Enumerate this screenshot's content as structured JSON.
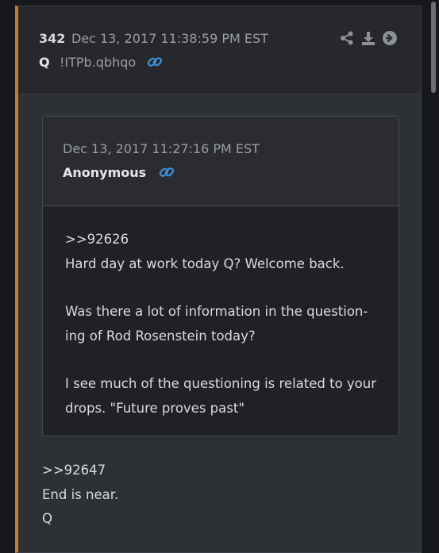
{
  "post": {
    "number": "342",
    "date": "Dec 13, 2017 11:38:59 PM EST",
    "author": "Q",
    "tripcode": "!ITPb.qbhqo",
    "icons": [
      "share-icon",
      "download-icon",
      "arrow-right-circle-icon",
      "link-icon"
    ],
    "accent_color": "#c87a35",
    "reply_lines": [
      ">>92647",
      "End is near.",
      "Q"
    ]
  },
  "quoted": {
    "date": "Dec 13, 2017 11:27:16 PM EST",
    "author": "Anonymous",
    "lines": [
      ">>92626",
      "Hard day at work today Q? Welcome back.",
      "",
      "Was there a lot of information in the question-",
      "ing of Rod Rosenstein today?",
      "",
      "I see much of the questioning is related to your",
      "drops.  \"Future proves past\""
    ]
  },
  "link_color": "#3b8fd6"
}
